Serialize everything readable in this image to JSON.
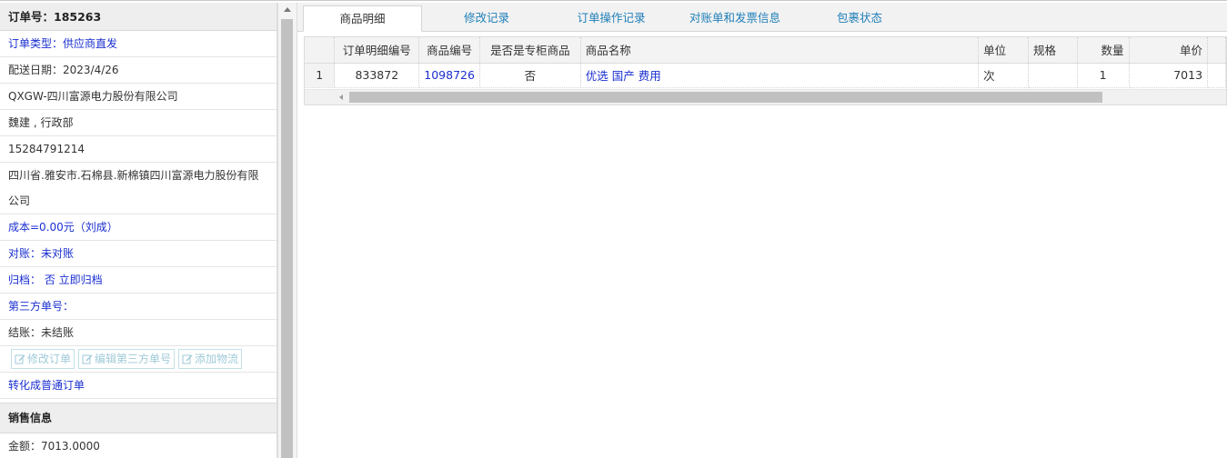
{
  "order": {
    "header": "订单号：185263",
    "type": "订单类型：供应商直发",
    "delivery_date": "配送日期：2023/4/26",
    "company": "QXGW-四川富源电力股份有限公司",
    "contact": "魏建 , 行政部",
    "phone": "15284791214",
    "address": "四川省.雅安市.石棉县.新棉镇四川富源电力股份有限公司",
    "cost": "成本=0.00元（刘成）",
    "reconcile": "对账：未对账",
    "archive_label": "归档： 否",
    "archive_now": "立即归档",
    "third_party": "第三方单号：",
    "settlement": "结账：未结账",
    "buttons": {
      "edit_order": "修改订单",
      "edit_third_party": "编辑第三方单号",
      "add_logistics": "添加物流"
    },
    "convert_link": "转化成普通订单"
  },
  "sales": {
    "title": "销售信息",
    "amount": "金额：7013.0000"
  },
  "tabs": [
    "商品明细",
    "修改记录",
    "订单操作记录",
    "对账单和发票信息",
    "包裹状态"
  ],
  "grid": {
    "headers": [
      "订单明细编号",
      "商品编号",
      "是否是专柜商品",
      "商品名称",
      "单位",
      "规格",
      "数量",
      "单价"
    ],
    "rows": [
      {
        "num": "1",
        "detail_id": "833872",
        "product_id": "1098726",
        "is_counter": "否",
        "name": "优选 国产 费用",
        "unit": "次",
        "spec": "",
        "qty": "1",
        "price": "7013"
      }
    ]
  },
  "colors": {
    "link_blue": "#1a2fd0",
    "tab_blue": "#1f7fb8"
  },
  "icons": {
    "button_icon": "edit-icon"
  }
}
